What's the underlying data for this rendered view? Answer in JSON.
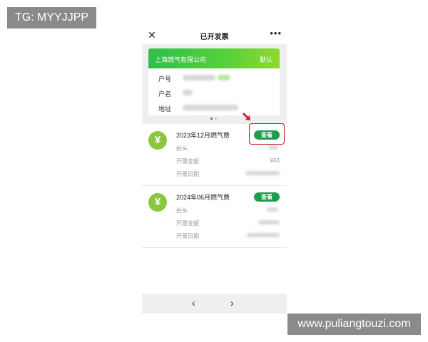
{
  "watermark_top": "TG: MYYJJPP",
  "watermark_bottom": "www.puliangtouzi.com",
  "header": {
    "title": "已开发票",
    "close_icon": "close-icon",
    "more_icon": "more-icon"
  },
  "account_card": {
    "company": "上海燃气有限公司",
    "default_label": "默认",
    "rows": [
      {
        "label": "户号"
      },
      {
        "label": "户名"
      },
      {
        "label": "地址"
      }
    ],
    "accent_colors": [
      "#2fbf4a",
      "#8fd92c"
    ]
  },
  "invoices": [
    {
      "title": "2023年12月燃气费",
      "view_label": "查看",
      "fields": [
        {
          "label": "抬头",
          "value": ""
        },
        {
          "label": "开票金额",
          "value": "¥63"
        },
        {
          "label": "开票日期",
          "value": ""
        }
      ]
    },
    {
      "title": "2024年06月燃气费",
      "view_label": "查看",
      "fields": [
        {
          "label": "抬头",
          "value": ""
        },
        {
          "label": "开票金额",
          "value": ""
        },
        {
          "label": "开票日期",
          "value": ""
        }
      ]
    }
  ],
  "icons": {
    "invoice_icon": "yen-icon",
    "prev": "chevron-left-icon",
    "next": "chevron-right-icon",
    "annotation": "red-arrow-icon"
  },
  "colors": {
    "primary_green": "#1f9d4f",
    "yen_green": "#8cc63f",
    "annotation_red": "#d2191f"
  }
}
